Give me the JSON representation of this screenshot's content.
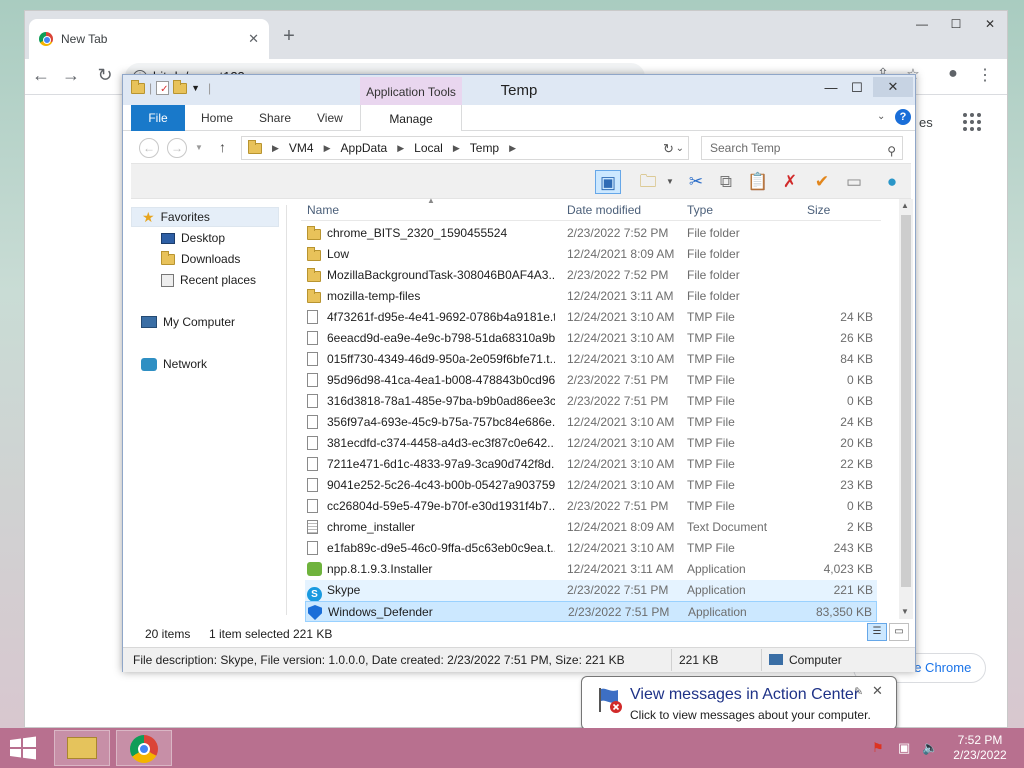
{
  "chrome": {
    "tab_title": "New Tab",
    "tab_close": "✕",
    "new_tab": "+",
    "url": "bit.do/vmset123",
    "right_text": "es",
    "customize_label": "mize Chrome",
    "ctl_min": "—",
    "ctl_max": "☐",
    "ctl_close": "✕"
  },
  "explorer": {
    "title": "Temp",
    "app_tools": "Application Tools",
    "ribbon": {
      "file": "File",
      "home": "Home",
      "share": "Share",
      "view": "View",
      "manage": "Manage"
    },
    "breadcrumb": [
      "VM4",
      "AppData",
      "Local",
      "Temp"
    ],
    "search_placeholder": "Search Temp",
    "nav": {
      "favorites": "Favorites",
      "desktop": "Desktop",
      "downloads": "Downloads",
      "recent": "Recent places",
      "computer": "My Computer",
      "network": "Network"
    },
    "columns": {
      "name": "Name",
      "date": "Date modified",
      "type": "Type",
      "size": "Size"
    },
    "files": [
      {
        "name": "chrome_BITS_2320_1590455524",
        "date": "2/23/2022 7:52 PM",
        "type": "File folder",
        "size": "",
        "icon": "folder-icon"
      },
      {
        "name": "Low",
        "date": "12/24/2021 8:09 AM",
        "type": "File folder",
        "size": "",
        "icon": "folder-icon"
      },
      {
        "name": "MozillaBackgroundTask-308046B0AF4A3...",
        "date": "2/23/2022 7:52 PM",
        "type": "File folder",
        "size": "",
        "icon": "folder-icon"
      },
      {
        "name": "mozilla-temp-files",
        "date": "12/24/2021 3:11 AM",
        "type": "File folder",
        "size": "",
        "icon": "folder-icon"
      },
      {
        "name": "4f73261f-d95e-4e41-9692-0786b4a9181e.t...",
        "date": "12/24/2021 3:10 AM",
        "type": "TMP File",
        "size": "24 KB",
        "icon": "file-icon"
      },
      {
        "name": "6eeacd9d-ea9e-4e9c-b798-51da68310a9b...",
        "date": "12/24/2021 3:10 AM",
        "type": "TMP File",
        "size": "26 KB",
        "icon": "file-icon"
      },
      {
        "name": "015ff730-4349-46d9-950a-2e059f6bfe71.t...",
        "date": "12/24/2021 3:10 AM",
        "type": "TMP File",
        "size": "84 KB",
        "icon": "file-icon"
      },
      {
        "name": "95d96d98-41ca-4ea1-b008-478843b0cd96...",
        "date": "2/23/2022 7:51 PM",
        "type": "TMP File",
        "size": "0 KB",
        "icon": "file-icon"
      },
      {
        "name": "316d3818-78a1-485e-97ba-b9b0ad86ee3c...",
        "date": "2/23/2022 7:51 PM",
        "type": "TMP File",
        "size": "0 KB",
        "icon": "file-icon"
      },
      {
        "name": "356f97a4-693e-45c9-b75a-757bc84e686e....",
        "date": "12/24/2021 3:10 AM",
        "type": "TMP File",
        "size": "24 KB",
        "icon": "file-icon"
      },
      {
        "name": "381ecdfd-c374-4458-a4d3-ec3f87c0e642....",
        "date": "12/24/2021 3:10 AM",
        "type": "TMP File",
        "size": "20 KB",
        "icon": "file-icon"
      },
      {
        "name": "7211e471-6d1c-4833-97a9-3ca90d742f8d....",
        "date": "12/24/2021 3:10 AM",
        "type": "TMP File",
        "size": "22 KB",
        "icon": "file-icon"
      },
      {
        "name": "9041e252-5c26-4c43-b00b-05427a903759....",
        "date": "12/24/2021 3:10 AM",
        "type": "TMP File",
        "size": "23 KB",
        "icon": "file-icon"
      },
      {
        "name": "cc26804d-59e5-479e-b70f-e30d1931f4b7....",
        "date": "2/23/2022 7:51 PM",
        "type": "TMP File",
        "size": "0 KB",
        "icon": "file-icon"
      },
      {
        "name": "chrome_installer",
        "date": "12/24/2021 8:09 AM",
        "type": "Text Document",
        "size": "2 KB",
        "icon": "text-file-icon"
      },
      {
        "name": "e1fab89c-d9e5-46c0-9ffa-d5c63eb0c9ea.t...",
        "date": "12/24/2021 3:10 AM",
        "type": "TMP File",
        "size": "243 KB",
        "icon": "file-icon"
      },
      {
        "name": "npp.8.1.9.3.Installer",
        "date": "12/24/2021 3:11 AM",
        "type": "Application",
        "size": "4,023 KB",
        "icon": "npp-icon"
      },
      {
        "name": "Skype",
        "date": "2/23/2022 7:51 PM",
        "type": "Application",
        "size": "221 KB",
        "icon": "skype-icon"
      },
      {
        "name": "Windows_Defender",
        "date": "2/23/2022 7:51 PM",
        "type": "Application",
        "size": "83,350 KB",
        "icon": "shield-icon"
      }
    ],
    "status": {
      "count": "20 items",
      "selected": "1 item selected",
      "sel_size": "221 KB"
    },
    "details": {
      "description": "File description: Skype, File version: 1.0.0.0, Date created: 2/23/2022 7:51 PM, Size: 221 KB",
      "size": "221 KB",
      "location": "Computer"
    }
  },
  "balloon": {
    "title": "View messages in Action Center",
    "body": "Click to view messages about your computer."
  },
  "taskbar": {
    "time": "7:52 PM",
    "date": "2/23/2022"
  }
}
